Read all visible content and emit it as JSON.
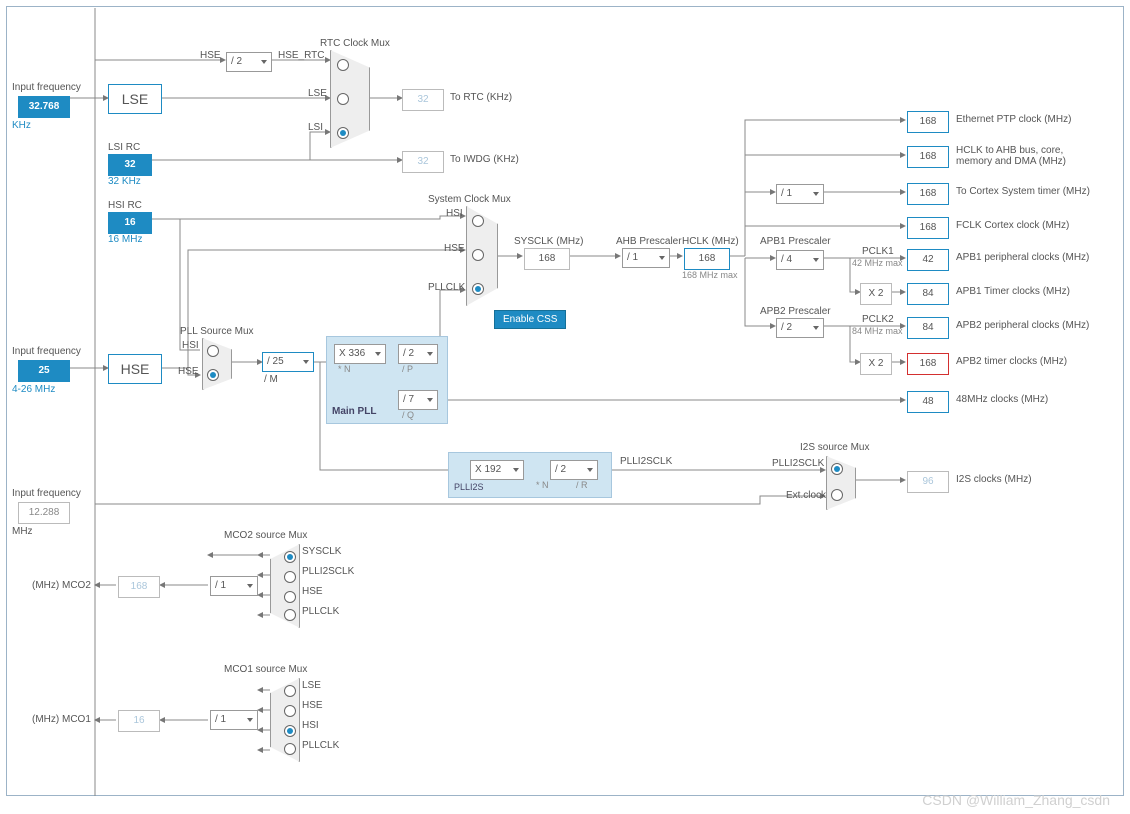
{
  "labels": {
    "input_freq": "Input frequency",
    "khz": "KHz",
    "mhz": "MHz",
    "lse_val": "32.768",
    "lse": "LSE",
    "lsi_rc": "LSI RC",
    "lsi_val": "32",
    "lsi_unit": "32 KHz",
    "hsi_rc": "HSI RC",
    "hsi_val": "16",
    "hsi_unit": "16 MHz",
    "hse_val": "25",
    "hse": "HSE",
    "hse_range": "4-26 MHz",
    "i2s_in": "12.288",
    "rtc_mux": "RTC Clock Mux",
    "sysclk_mux": "System Clock Mux",
    "pll_src_mux": "PLL Source Mux",
    "main_pll": "Main PLL",
    "plli2s": "PLLI2S",
    "i2s_mux": "I2S source Mux",
    "mco2_mux": "MCO2 source Mux",
    "mco1_mux": "MCO1 source Mux",
    "enable_css": "Enable CSS",
    "hse_sig": "HSE",
    "hse_rtc": "HSE_RTC",
    "lse_sig": "LSE",
    "lsi_sig": "LSI",
    "hsi_sig": "HSI",
    "pllclk_sig": "PLLCLK",
    "sysclk": "SYSCLK (MHz)",
    "ahb_pre": "AHB Prescaler",
    "hclk": "HCLK (MHz)",
    "hclk_max": "168 MHz max",
    "apb1_pre": "APB1 Prescaler",
    "apb2_pre": "APB2 Prescaler",
    "pclk1": "PCLK1",
    "pclk1_max": "42 MHz max",
    "pclk2": "PCLK2",
    "pclk2_max": "84 MHz max",
    "plli2sclk": "PLLI2SCLK",
    "extclk": "Ext.clock",
    "to_rtc": "To RTC (KHz)",
    "to_iwdg": "To IWDG (KHz)",
    "eth_ptp": "Ethernet PTP clock (MHz)",
    "hclk_ahb": "HCLK to AHB bus, core,",
    "hclk_ahb2": "memory and DMA (MHz)",
    "cortex_sys": "To Cortex System timer (MHz)",
    "fclk": "FCLK Cortex clock (MHz)",
    "apb1_per": "APB1 peripheral clocks (MHz)",
    "apb1_tim": "APB1 Timer clocks (MHz)",
    "apb2_per": "APB2 peripheral clocks (MHz)",
    "apb2_tim": "APB2 timer clocks (MHz)",
    "clk48": "48MHz clocks (MHz)",
    "i2s_clk": "I2S clocks (MHz)",
    "mco2": "(MHz) MCO2",
    "mco1": "(MHz) MCO1",
    "sysclk_sig": "SYSCLK",
    "plli2sclk_sig": "PLLI2SCLK",
    "div_m": "/ M",
    "mul_n": "* N",
    "div_p": "/ P",
    "div_q": "/ Q",
    "div_r": "/ R"
  },
  "values": {
    "rtc_div": "/ 2",
    "rtc_out": "32",
    "iwdg_out": "32",
    "pllm": "/ 25",
    "plln": "X 336",
    "pllp": "/ 2",
    "pllq": "/ 7",
    "i2sn": "X 192",
    "i2sr": "/ 2",
    "sysclk": "168",
    "ahb_div": "/ 1",
    "hclk": "168",
    "cortex_div": "/ 1",
    "apb1_div": "/ 4",
    "apb2_div": "/ 2",
    "apb1_tim_mul": "X 2",
    "apb2_tim_mul": "X 2",
    "eth": "168",
    "hclk_bus": "168",
    "cortex_sys": "168",
    "fclk": "168",
    "pclk1": "42",
    "apb1_tim": "84",
    "pclk2": "84",
    "apb2_tim": "168",
    "clk48": "48",
    "i2s": "96",
    "mco2_div": "/ 1",
    "mco2_val": "168",
    "mco1_div": "/ 1",
    "mco1_val": "16"
  },
  "watermark": "CSDN @William_Zhang_csdn"
}
